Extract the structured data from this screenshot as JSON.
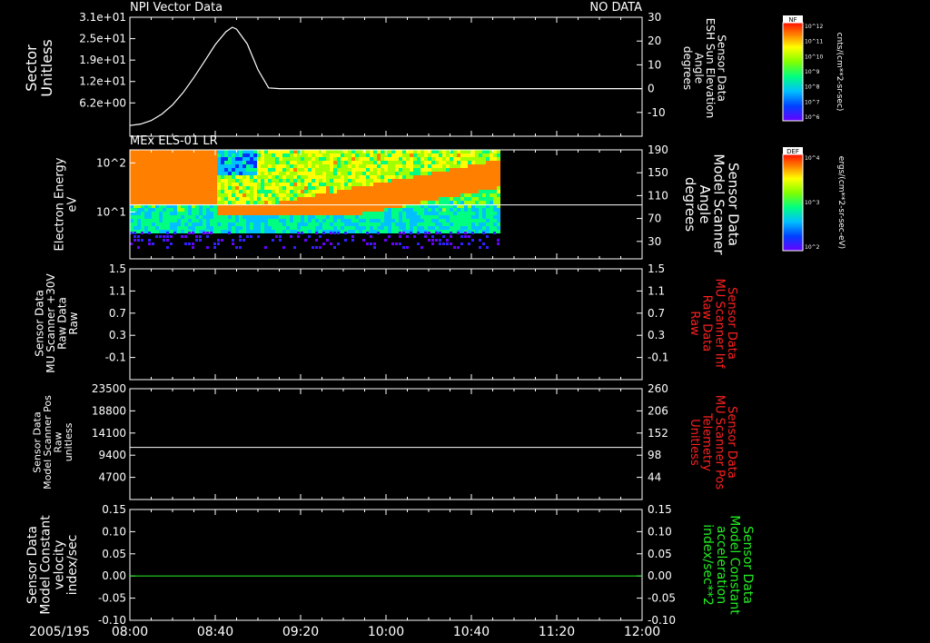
{
  "chart_data": [
    {
      "type": "line",
      "title": "NPI Vector Data",
      "status": "NO DATA",
      "ylabel_left": [
        "Sector",
        "Unitless"
      ],
      "ylabel_right": [
        "Sensor Data",
        "ESH Sun Elevation",
        "Angle",
        "degrees"
      ],
      "left_ticks": [
        "3.1e+01",
        "2.5e+01",
        "1.9e+01",
        "1.2e+01",
        "6.2e+00"
      ],
      "right_ticks": [
        "30",
        "20",
        "10",
        "0",
        "-10"
      ],
      "ylim_right": [
        -20,
        30
      ],
      "series": [
        {
          "color": "#ffffff",
          "x": [
            0,
            5,
            10,
            15,
            20,
            25,
            30,
            35,
            40,
            45,
            48,
            50,
            55,
            60,
            65,
            70,
            75,
            80,
            90,
            100,
            120,
            140,
            160,
            180,
            200,
            220,
            240
          ],
          "y": [
            -15.5,
            -14.9,
            -13.4,
            -10.7,
            -6.8,
            -1.6,
            4.7,
            11.5,
            18.5,
            23.9,
            25.8,
            25.0,
            18.8,
            8.0,
            0.3,
            0.0,
            0.0,
            0.0,
            0.0,
            0.0,
            0.0,
            0.0,
            0.0,
            0.0,
            0.0,
            0.0,
            0.0
          ]
        }
      ],
      "colorbar": {
        "label": "cnts/(cm**2-sr-sec)",
        "tag": "NF",
        "ticks": [
          "10^12",
          "10^11",
          "10^10",
          "10^9",
          "10^8",
          "10^7",
          "10^6"
        ]
      }
    },
    {
      "type": "heatmap",
      "title": "MEx ELS-01 LR",
      "ylabel_left": [
        "Electron Energy",
        "eV"
      ],
      "ylabel_right": [
        "Sensor Data",
        "Model Scanner",
        "Angle",
        "degrees"
      ],
      "left_ticks": [
        "10^2",
        "10^1"
      ],
      "right_ticks": [
        "190",
        "150",
        "110",
        "70",
        "30"
      ],
      "ylim_right": [
        0,
        190
      ],
      "data_x_range": [
        0,
        173
      ],
      "overlay_line_y": 94,
      "colorbar": {
        "label": "ergs/(cm**2-sr-sec-eV)",
        "tag": "DEF",
        "ticks": [
          "10^4",
          "10^3",
          "10^2"
        ]
      }
    },
    {
      "type": "line",
      "ylabel_left": [
        "Sensor Data",
        "MU Scanner +30V",
        "Raw Data",
        "Raw"
      ],
      "ylabel_right": [
        "Sensor Data",
        "MU Scanner Inf",
        "Raw Data",
        "Raw"
      ],
      "ylabel_right_color": "#ff2020",
      "left_ticks": [
        "1.5",
        "1.1",
        "0.7",
        "0.3",
        "-0.1"
      ],
      "right_ticks": [
        "1.5",
        "1.1",
        "0.7",
        "0.3",
        "-0.1"
      ]
    },
    {
      "type": "line",
      "ylabel_left": [
        "Sensor Data",
        "Model Scanner Pos",
        "Raw",
        "unitless"
      ],
      "ylabel_right": [
        "Sensor Data",
        "MU Scanner Pos",
        "Telemetry",
        "Unitless"
      ],
      "ylabel_right_color": "#ff2020",
      "left_ticks": [
        "23500",
        "18800",
        "14100",
        "9400",
        "4700"
      ],
      "right_ticks": [
        "260",
        "206",
        "152",
        "98",
        "44"
      ],
      "ylim_right": [
        -10,
        260
      ],
      "series": [
        {
          "color": "#ffffff",
          "y_const_right": 117
        }
      ]
    },
    {
      "type": "line",
      "ylabel_left": [
        "Sensor Data",
        "Model Constant",
        "velocity",
        "index/sec"
      ],
      "ylabel_right": [
        "Sensor Data",
        "Model Constant",
        "acceleration",
        "index/sec**2"
      ],
      "ylabel_right_color": "#22ee22",
      "left_ticks": [
        "0.15",
        "0.10",
        "0.05",
        "0.00",
        "-0.05",
        "-0.10"
      ],
      "right_ticks": [
        "0.15",
        "0.10",
        "0.05",
        "0.00",
        "-0.05",
        "-0.10"
      ],
      "ylim": [
        -0.1,
        0.15
      ],
      "series": [
        {
          "color": "#22dd22",
          "y_const": 0.0
        }
      ]
    }
  ],
  "x_axis": {
    "date": "2005/195",
    "ticks": [
      "08:00",
      "08:40",
      "09:20",
      "10:00",
      "10:40",
      "11:20",
      "12:00"
    ],
    "range_minutes": [
      0,
      240
    ]
  }
}
